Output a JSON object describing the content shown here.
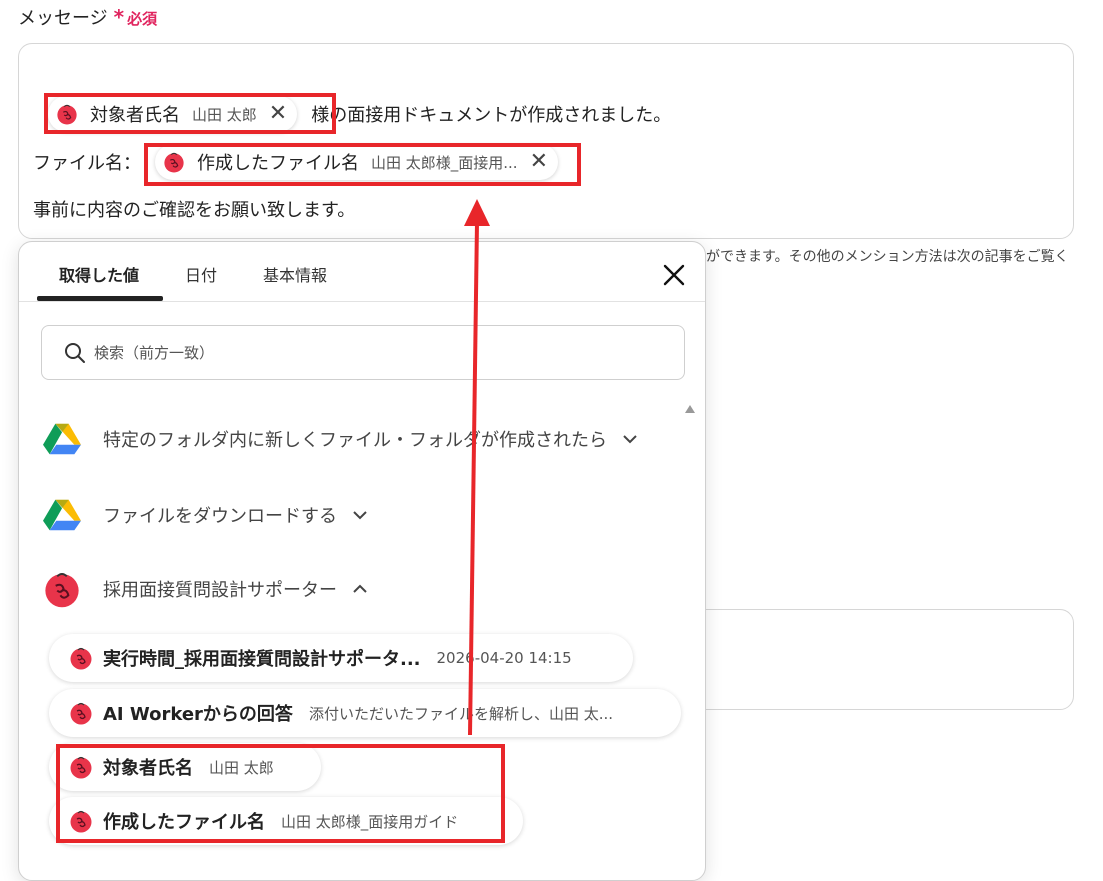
{
  "field": {
    "label": "メッセージ",
    "required_mark": "*",
    "required_label": "必須"
  },
  "message": {
    "line1_suffix": "様の面接用ドキュメントが作成されました。",
    "line2_prefix": "ファイル名：",
    "line3": "事前に内容のご確認をお願い致します。",
    "chip1": {
      "name": "対象者氏名",
      "value": "山田 太郎"
    },
    "chip2": {
      "name": "作成したファイル名",
      "value": "山田 太郎様_面接用..."
    }
  },
  "hint_text": "ができます。その他のメンション方法は次の記事をご覧く",
  "popover": {
    "tabs": [
      "取得した値",
      "日付",
      "基本情報"
    ],
    "active_tab": "取得した値",
    "search_placeholder": "検索（前方一致）",
    "groups": [
      {
        "label": "特定のフォルダ内に新しくファイル・フォルダが作成されたら",
        "icon": "google-drive-icon",
        "expanded": false
      },
      {
        "label": "ファイルをダウンロードする",
        "icon": "google-drive-icon",
        "expanded": false
      },
      {
        "label": "採用面接質問設計サポーター",
        "icon": "ai-worker-icon",
        "expanded": true
      }
    ],
    "items": [
      {
        "name": "実行時間_採用面接質問設計サポータ...",
        "value": "2026-04-20 14:15"
      },
      {
        "name": "AI Workerからの回答",
        "value": "添付いただいたファイルを解析し、山田 太..."
      },
      {
        "name": "対象者氏名",
        "value": "山田 太郎"
      },
      {
        "name": "作成したファイル名",
        "value": "山田 太郎様_面接用ガイド"
      }
    ]
  },
  "colors": {
    "accent_red": "#e8262a",
    "required_pink": "#e0245e",
    "ai_icon_red": "#e8344a"
  }
}
